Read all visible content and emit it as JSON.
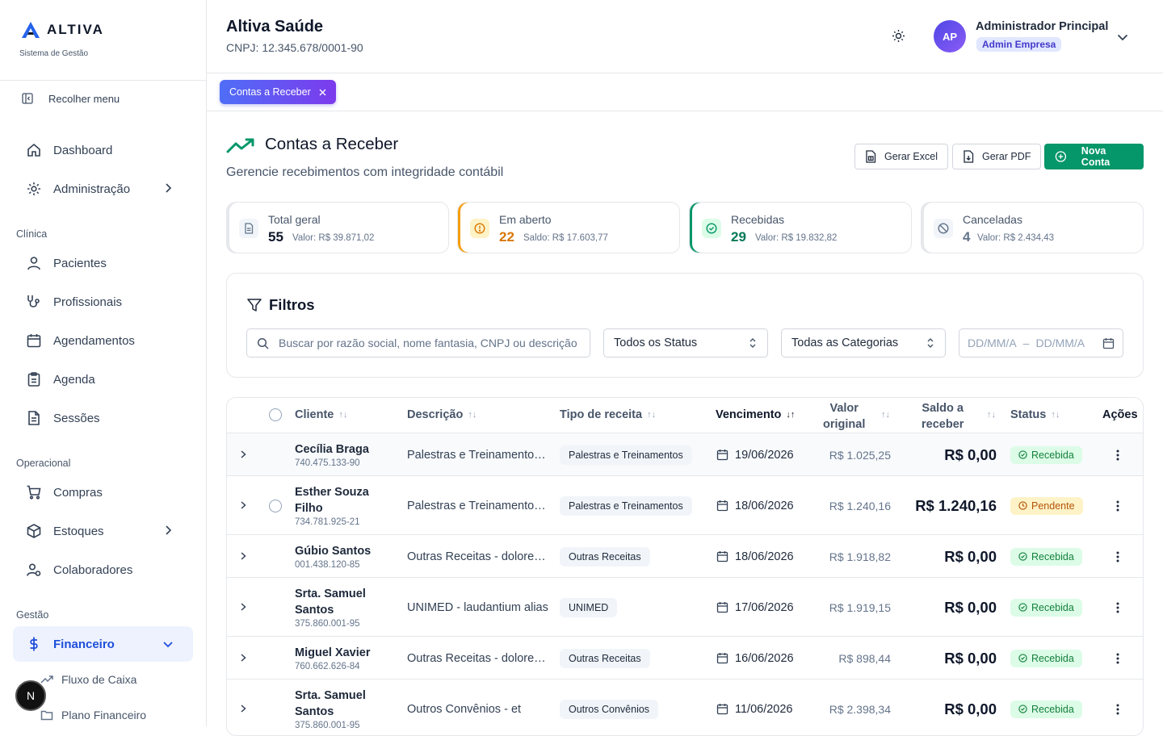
{
  "brand": {
    "name": "ALTIVA",
    "subtitle": "Sistema de Gestão"
  },
  "sidebar": {
    "collapse_label": "Recolher menu",
    "items": [
      {
        "label": "Dashboard",
        "icon": "home-icon"
      },
      {
        "label": "Administração",
        "icon": "gear-icon"
      }
    ],
    "sections": [
      {
        "title": "Clínica",
        "items": [
          {
            "label": "Pacientes",
            "icon": "user-icon"
          },
          {
            "label": "Profissionais",
            "icon": "stethoscope-icon"
          },
          {
            "label": "Agendamentos",
            "icon": "calendar-icon"
          },
          {
            "label": "Agenda",
            "icon": "clipboard-icon"
          },
          {
            "label": "Sessões",
            "icon": "document-icon"
          }
        ]
      },
      {
        "title": "Operacional",
        "items": [
          {
            "label": "Compras",
            "icon": "cart-icon"
          },
          {
            "label": "Estoques",
            "icon": "box-icon"
          },
          {
            "label": "Colaboradores",
            "icon": "users-icon"
          }
        ]
      },
      {
        "title": "Gestão",
        "items": [
          {
            "label": "Financeiro",
            "icon": "dollar-icon"
          }
        ]
      }
    ],
    "sub_items": [
      {
        "label": "Fluxo de Caixa",
        "icon": "trend-icon"
      },
      {
        "label": "Plano Financeiro",
        "icon": "folder-icon"
      }
    ],
    "bottom_avatar": "N"
  },
  "header": {
    "company": "Altiva Saúde",
    "cnpj": "CNPJ: 12.345.678/0001-90",
    "user_initials": "AP",
    "user_name": "Administrador Principal",
    "user_role": "Admin Empresa"
  },
  "tabs": [
    {
      "label": "Contas a Receber"
    }
  ],
  "page": {
    "title": "Contas a Receber",
    "subtitle": "Gerencie recebimentos com integridade contábil",
    "btn_excel": "Gerar Excel",
    "btn_pdf": "Gerar PDF",
    "btn_new": "Nova Conta"
  },
  "cards": [
    {
      "label": "Total geral",
      "count": "55",
      "value": "Valor: R$ 39.871,02",
      "accent": "#64748b"
    },
    {
      "label": "Em aberto",
      "count": "22",
      "value": "Saldo: R$ 17.603,77",
      "accent": "#f59e0b"
    },
    {
      "label": "Recebidas",
      "count": "29",
      "value": "Valor: R$ 19.832,82",
      "accent": "#059669"
    },
    {
      "label": "Canceladas",
      "count": "4",
      "value": "Valor: R$ 2.434,43",
      "accent": "#94a3b8"
    }
  ],
  "filters": {
    "title": "Filtros",
    "search_placeholder": "Buscar por razão social, nome fantasia, CNPJ ou descrição",
    "status": "Todos os Status",
    "category": "Todas as Categorias",
    "date_from": "DD/MM/A",
    "date_sep": "–",
    "date_to": "DD/MM/A"
  },
  "table": {
    "columns": {
      "cliente": "Cliente",
      "descricao": "Descrição",
      "tipo": "Tipo de receita",
      "vencimento": "Vencimento",
      "valor_l1": "Valor",
      "valor_l2": "original",
      "saldo_l1": "Saldo a",
      "saldo_l2": "receber",
      "status": "Status",
      "acoes": "Ações"
    },
    "rows": [
      {
        "name": "Cecília Braga",
        "doc": "740.475.133-90",
        "desc": "Palestras e Treinamentos - placeat",
        "tipo": "Palestras e Treinamentos",
        "venc": "19/06/2026",
        "orig": "R$ 1.025,25",
        "saldo": "R$ 0,00",
        "status": "Recebida"
      },
      {
        "name": "Esther Souza Filho",
        "doc": "734.781.925-21",
        "desc": "Palestras e Treinamentos - quia",
        "tipo": "Palestras e Treinamentos",
        "venc": "18/06/2026",
        "orig": "R$ 1.240,16",
        "saldo": "R$ 1.240,16",
        "status": "Pendente"
      },
      {
        "name": "Gúbio Santos",
        "doc": "001.438.120-85",
        "desc": "Outras Receitas - dolores et",
        "tipo": "Outras Receitas",
        "venc": "18/06/2026",
        "orig": "R$ 1.918,82",
        "saldo": "R$ 0,00",
        "status": "Recebida"
      },
      {
        "name": "Srta. Samuel Santos",
        "doc": "375.860.001-95",
        "desc": "UNIMED - laudantium alias",
        "tipo": "UNIMED",
        "venc": "17/06/2026",
        "orig": "R$ 1.919,15",
        "saldo": "R$ 0,00",
        "status": "Recebida"
      },
      {
        "name": "Miguel Xavier",
        "doc": "760.662.626-84",
        "desc": "Outras Receitas - dolores ut",
        "tipo": "Outras Receitas",
        "venc": "16/06/2026",
        "orig": "R$ 898,44",
        "saldo": "R$ 0,00",
        "status": "Recebida"
      },
      {
        "name": "Srta. Samuel Santos",
        "doc": "375.860.001-95",
        "desc": "Outros Convênios - et",
        "tipo": "Outros Convênios",
        "venc": "11/06/2026",
        "orig": "R$ 2.398,34",
        "saldo": "R$ 0,00",
        "status": "Recebida"
      }
    ]
  },
  "colors": {
    "brand_blue": "#2563eb",
    "accent_green": "#059669",
    "tab_gradient_start": "#4f6ef7",
    "tab_gradient_end": "#7c3aed"
  }
}
